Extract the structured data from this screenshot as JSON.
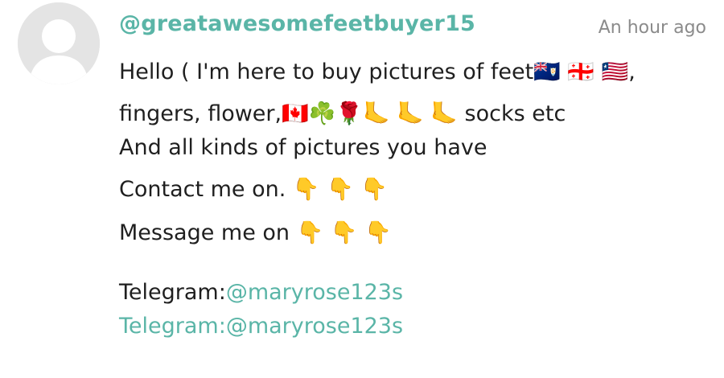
{
  "comment": {
    "username": "@greatawesomefeetbuyer15",
    "timestamp": "An hour ago",
    "lines": {
      "line1": "Hello ( I'm here to buy pictures of feet🇦🇮 🇬🇪 🇱🇷,",
      "line2": "fingers, flower,🇨🇦☘️🌹🦶 🦶 🦶  socks etc",
      "line3": "And all kinds of pictures you have",
      "line4": "Contact me on.  👇 👇 👇",
      "line5": "Message me on 👇 👇 👇"
    },
    "links": [
      {
        "prefix": "Telegram:",
        "handle": "@maryrose123s"
      },
      {
        "prefix": "Telegram:",
        "handle": "@maryrose123s"
      }
    ]
  },
  "colors": {
    "accent": "#5ab5a7",
    "text": "#1f1f1f",
    "muted": "#8b8b8b",
    "avatar_bg": "#e4e4e4"
  },
  "icons": {
    "avatar": "default-user-avatar-icon"
  }
}
